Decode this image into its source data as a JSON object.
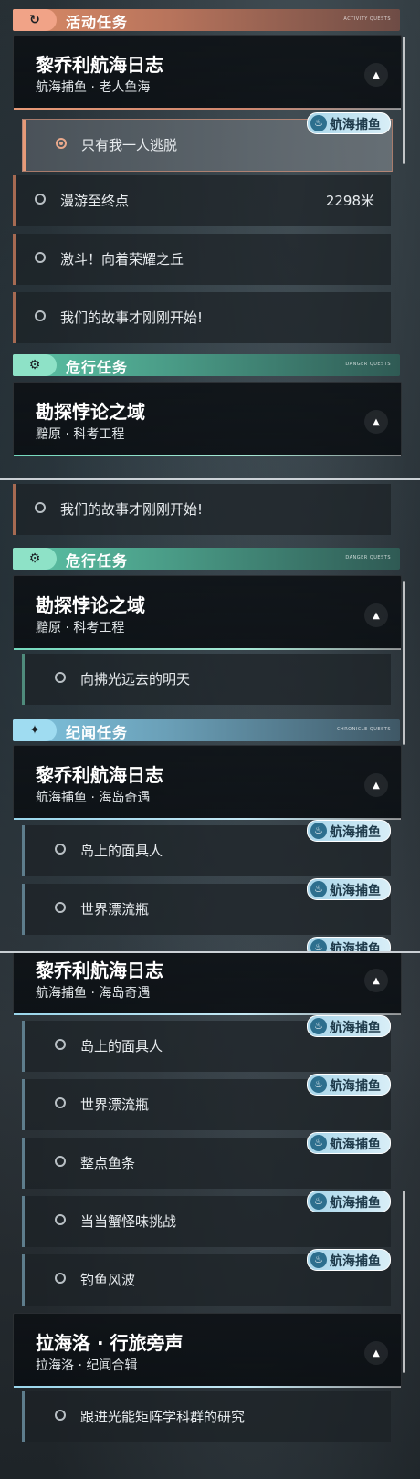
{
  "sections": {
    "active": {
      "title": "活动任务",
      "tag": "ACTIVITY QUESTS",
      "icon": "↻"
    },
    "danger": {
      "title": "危行任务",
      "tag": "DANGER QUESTS",
      "icon": "⚙"
    },
    "chronicle": {
      "title": "纪闻任务",
      "tag": "CHRONICLE QUESTS",
      "icon": "✦"
    }
  },
  "quests": {
    "lijiao_oldman": {
      "title": "黎乔利航海日志",
      "subtitle": "航海捕鱼 · 老人鱼海"
    },
    "kantan": {
      "title": "勘探悖论之域",
      "subtitle": "黯原 · 科考工程"
    },
    "lijiao_island": {
      "title": "黎乔利航海日志",
      "subtitle": "航海捕鱼 · 海岛奇遇"
    },
    "lahailuo": {
      "title": "拉海洛 · 行旅旁声",
      "subtitle": "拉海洛 · 纪闻合辑"
    }
  },
  "objectives": {
    "escape": "只有我一人逃脱",
    "roam": "漫游至终点",
    "roam_distance": "2298米",
    "fight": "激斗！向着荣耀之丘",
    "story": "我们的故事才刚刚开始!",
    "tomorrow": "向拂光远去的明天",
    "mask": "岛上的面具人",
    "bottle": "世界漂流瓶",
    "fish": "整点鱼条",
    "crab": "当当蟹怪味挑战",
    "waves": "钓鱼风波",
    "research": "跟进光能矩阵学科群的研究"
  },
  "badge": {
    "label": "航海捕鱼",
    "icon": "♨"
  },
  "collapse_icon": "▲"
}
